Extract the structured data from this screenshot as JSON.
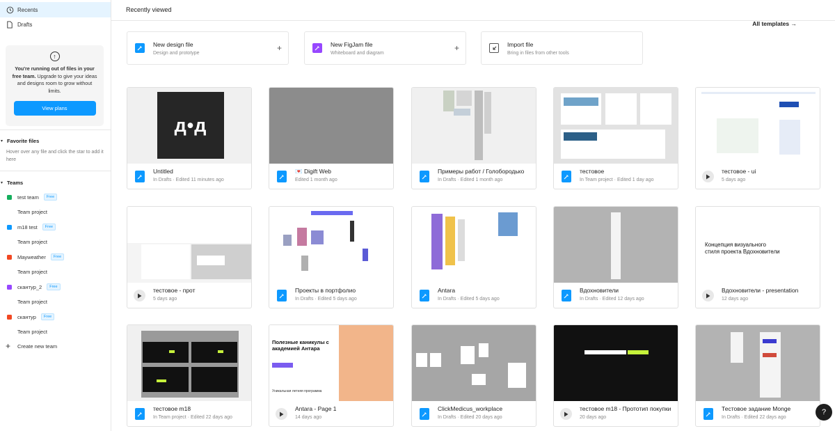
{
  "sidebar": {
    "recents": "Recents",
    "drafts": "Drafts",
    "upsell": {
      "title": "You're running out of files in your free team.",
      "body": " Upgrade to give your ideas and designs room to grow without limits.",
      "button": "View plans"
    },
    "favorites": {
      "heading": "Favorite files",
      "hint": "Hover over any file and click the star to add it here"
    },
    "teams": {
      "heading": "Teams",
      "items": [
        {
          "name": "test team",
          "badge": "Free",
          "color": "#14ae5c",
          "project": "Team project"
        },
        {
          "name": "m18 test",
          "badge": "Free",
          "color": "#0d99ff",
          "project": "Team project"
        },
        {
          "name": "Mayweather",
          "badge": "Free",
          "color": "#f24822",
          "project": "Team project"
        },
        {
          "name": "скантур_2",
          "badge": "Free",
          "color": "#9747ff",
          "project": "Team project"
        },
        {
          "name": "скантур",
          "badge": "Free",
          "color": "#f24822",
          "project": "Team project"
        }
      ],
      "create": "Create new team"
    }
  },
  "main": {
    "title": "Recently viewed",
    "all_templates": "All templates →",
    "create_cards": [
      {
        "title": "New design file",
        "subtitle": "Design and prototype",
        "icon": "design-file-icon",
        "plus": "+"
      },
      {
        "title": "New FigJam file",
        "subtitle": "Whiteboard and diagram",
        "icon": "figjam-icon",
        "plus": "+"
      },
      {
        "title": "Import file",
        "subtitle": "Bring in files from other tools",
        "icon": "import-icon",
        "plus": ""
      }
    ],
    "files": [
      {
        "name": "Untitled",
        "sub": "In Drafts · Edited 11 minutes ago",
        "kind": "design"
      },
      {
        "name": "💌 Digift Web",
        "sub": "Edited 1 month ago",
        "kind": "design"
      },
      {
        "name": "Примеры работ / Голобородько",
        "sub": "In Drafts · Edited 1 month ago",
        "kind": "design"
      },
      {
        "name": "тестовое",
        "sub": "In Team project · Edited 1 day ago",
        "kind": "design"
      },
      {
        "name": "тестовое - ui",
        "sub": "5 days ago",
        "kind": "prototype"
      },
      {
        "name": "тестовое - прот",
        "sub": "5 days ago",
        "kind": "prototype"
      },
      {
        "name": "Проекты в портфолио",
        "sub": "In Drafts · Edited 5 days ago",
        "kind": "design"
      },
      {
        "name": "Antara",
        "sub": "In Drafts · Edited 5 days ago",
        "kind": "design"
      },
      {
        "name": "Вдохновители",
        "sub": "In Drafts · Edited 12 days ago",
        "kind": "design"
      },
      {
        "name": "Вдохновители - presentation",
        "sub": "12 days ago",
        "kind": "prototype"
      },
      {
        "name": "тестовое m18",
        "sub": "In Team project · Edited 22 days ago",
        "kind": "design"
      },
      {
        "name": "Antara - Page 1",
        "sub": "14 days ago",
        "kind": "prototype"
      },
      {
        "name": "ClickMedicus_workplace",
        "sub": "In Drafts · Edited 20 days ago",
        "kind": "design"
      },
      {
        "name": "тестовое m18 - Прототип покупки",
        "sub": "20 days ago",
        "kind": "prototype"
      },
      {
        "name": "Тестовое задание Monge",
        "sub": "In Drafts · Edited 22 days ago",
        "kind": "design"
      }
    ],
    "thumb_text": {
      "untitled_logo": "д•д",
      "vdokh_title": "Концепция визуального стиля проекта Вдохновители",
      "antara_headline": "Полезные каникулы с академией Антара",
      "antara_sub": "Уникальная летняя программа"
    }
  },
  "help": "?"
}
